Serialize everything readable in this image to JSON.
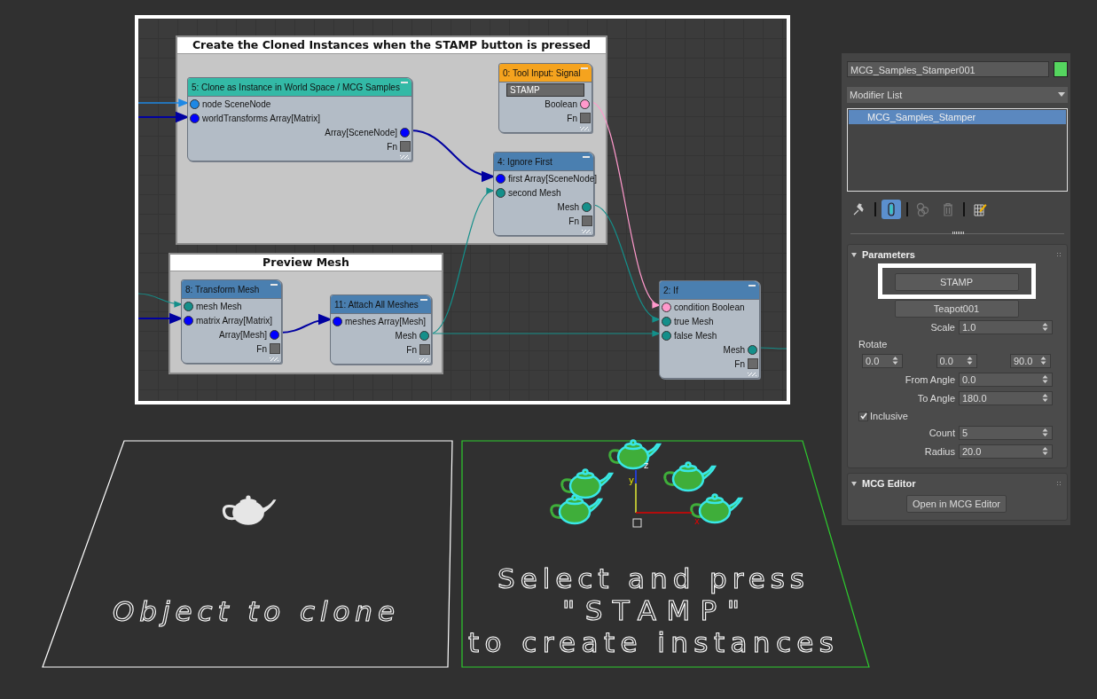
{
  "graph": {
    "groups": [
      {
        "title": "Create the Cloned Instances when the STAMP button is pressed"
      },
      {
        "title": "Preview Mesh"
      }
    ],
    "nodes": [
      {
        "title": "5: Clone as Instance in World Space / MCG Samples",
        "color": "#33b9a6",
        "inputs": [
          {
            "label": "node SceneNode",
            "color": "#1e88e5"
          },
          {
            "label": "worldTransforms Array[Matrix]",
            "color": "#0000ff"
          }
        ],
        "outputs": [
          {
            "kind": "pin",
            "label": "Array[SceneNode]",
            "color": "#0000ff"
          },
          {
            "kind": "fn",
            "label": "Fn"
          }
        ]
      },
      {
        "title": "0: Tool Input: Signal",
        "color": "#f5a31e",
        "field": "STAMP",
        "outputs": [
          {
            "kind": "pin",
            "label": "Boolean",
            "color": "#ff99cc"
          },
          {
            "kind": "fn",
            "label": "Fn"
          }
        ]
      },
      {
        "title": "4: Ignore First",
        "color": "#4a7fb0",
        "inputs": [
          {
            "label": "first Array[SceneNode]",
            "color": "#0000ff"
          },
          {
            "label": "second Mesh",
            "color": "#148f8a"
          }
        ],
        "outputs": [
          {
            "kind": "pin",
            "label": "Mesh",
            "color": "#148f8a"
          },
          {
            "kind": "fn",
            "label": "Fn"
          }
        ]
      },
      {
        "title": "8: Transform Mesh",
        "color": "#4a7fb0",
        "inputs": [
          {
            "label": "mesh Mesh",
            "color": "#148f8a"
          },
          {
            "label": "matrix Array[Matrix]",
            "color": "#0000ff"
          }
        ],
        "outputs": [
          {
            "kind": "pin",
            "label": "Array[Mesh]",
            "color": "#0000ff"
          },
          {
            "kind": "fn",
            "label": "Fn"
          }
        ]
      },
      {
        "title": "11: Attach All Meshes",
        "color": "#4a7fb0",
        "inputs": [
          {
            "label": "meshes Array[Mesh]",
            "color": "#0000ff"
          }
        ],
        "outputs": [
          {
            "kind": "pin",
            "label": "Mesh",
            "color": "#148f8a"
          },
          {
            "kind": "fn",
            "label": "Fn"
          }
        ]
      },
      {
        "title": "2: If",
        "color": "#4a7fb0",
        "inputs": [
          {
            "label": "condition Boolean",
            "color": "#ff99cc"
          },
          {
            "label": "true Mesh",
            "color": "#148f8a"
          },
          {
            "label": "false Mesh",
            "color": "#148f8a"
          }
        ],
        "outputs": [
          {
            "kind": "pin",
            "label": "Mesh",
            "color": "#148f8a"
          },
          {
            "kind": "fn",
            "label": "Fn"
          }
        ]
      }
    ]
  },
  "viewports": [
    {
      "caption": [
        "Object to clone"
      ]
    },
    {
      "caption": [
        "Select and press",
        "\"STAMP\"",
        "to create instances"
      ],
      "axis_labels": [
        "z",
        "y",
        "x"
      ]
    }
  ],
  "command_panel": {
    "object_name": "MCG_Samples_Stamper001",
    "modifier_list": "Modifier List",
    "modifier_stack": [
      {
        "label": "MCG_Samples_Stamper",
        "selected": true
      }
    ],
    "stack_tools": [
      {
        "kind": "pin",
        "on": false
      },
      {
        "kind": "show-end-result",
        "on": true
      },
      {
        "kind": "make-unique",
        "on": false
      },
      {
        "kind": "remove",
        "on": false
      },
      {
        "kind": "configure",
        "on": false
      }
    ],
    "rollouts": [
      {
        "title": "Parameters",
        "expanded": true,
        "controls": [
          {
            "kind": "button",
            "label": "STAMP",
            "highlighted": true
          },
          {
            "kind": "picker",
            "label": "Teapot001"
          },
          {
            "kind": "spinner",
            "label": "Scale",
            "value": "1.0"
          },
          {
            "kind": "heading",
            "label": "Rotate"
          },
          {
            "kind": "spinner-row",
            "values": [
              "0.0",
              "0.0",
              "90.0"
            ]
          },
          {
            "kind": "spinner",
            "label": "From Angle",
            "value": "0.0"
          },
          {
            "kind": "spinner",
            "label": "To Angle",
            "value": "180.0"
          },
          {
            "kind": "checkbox",
            "label": "Inclusive",
            "checked": true
          },
          {
            "kind": "spinner",
            "label": "Count",
            "value": "5"
          },
          {
            "kind": "spinner",
            "label": "Radius",
            "value": "20.0"
          }
        ]
      },
      {
        "title": "MCG Editor",
        "expanded": true,
        "controls": [
          {
            "kind": "button",
            "label": "Open in MCG Editor",
            "highlighted": false
          }
        ]
      }
    ]
  }
}
